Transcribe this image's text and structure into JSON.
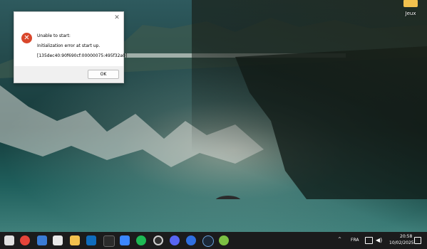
{
  "desktop": {
    "icons": [
      {
        "label": "Jeux",
        "icon": "folder-icon"
      }
    ]
  },
  "dialog": {
    "title_line": "Unable to start:",
    "message": "Initialization error at start up.",
    "code": "[135dec40:90f690cf:00000075:495f32a0]",
    "ok_label": "OK",
    "close_glyph": "✕",
    "error_glyph": "✕"
  },
  "taskbar": {
    "apps": [
      {
        "name": "task-view",
        "color": "#ffffff"
      },
      {
        "name": "chrome",
        "color": "#e5443a"
      },
      {
        "name": "calculator",
        "color": "#3a7bd5"
      },
      {
        "name": "photos",
        "color": "#e8e8e8"
      },
      {
        "name": "file-explorer",
        "color": "#f2c14e"
      },
      {
        "name": "outlook",
        "color": "#0f6cbd"
      },
      {
        "name": "terminal",
        "color": "#2b2b2b"
      },
      {
        "name": "todo",
        "color": "#3a86ff"
      },
      {
        "name": "spotify",
        "color": "#1db954"
      },
      {
        "name": "obs",
        "color": "#303030"
      },
      {
        "name": "discord",
        "color": "#5865f2"
      },
      {
        "name": "edge-canary",
        "color": "#2f6fe0"
      },
      {
        "name": "steam",
        "color": "#1b2838"
      },
      {
        "name": "green-app",
        "color": "#7bc043"
      }
    ],
    "tray": {
      "chevron": "^",
      "language": "FRA",
      "time": "20:58",
      "date": "10/02/2025"
    }
  }
}
